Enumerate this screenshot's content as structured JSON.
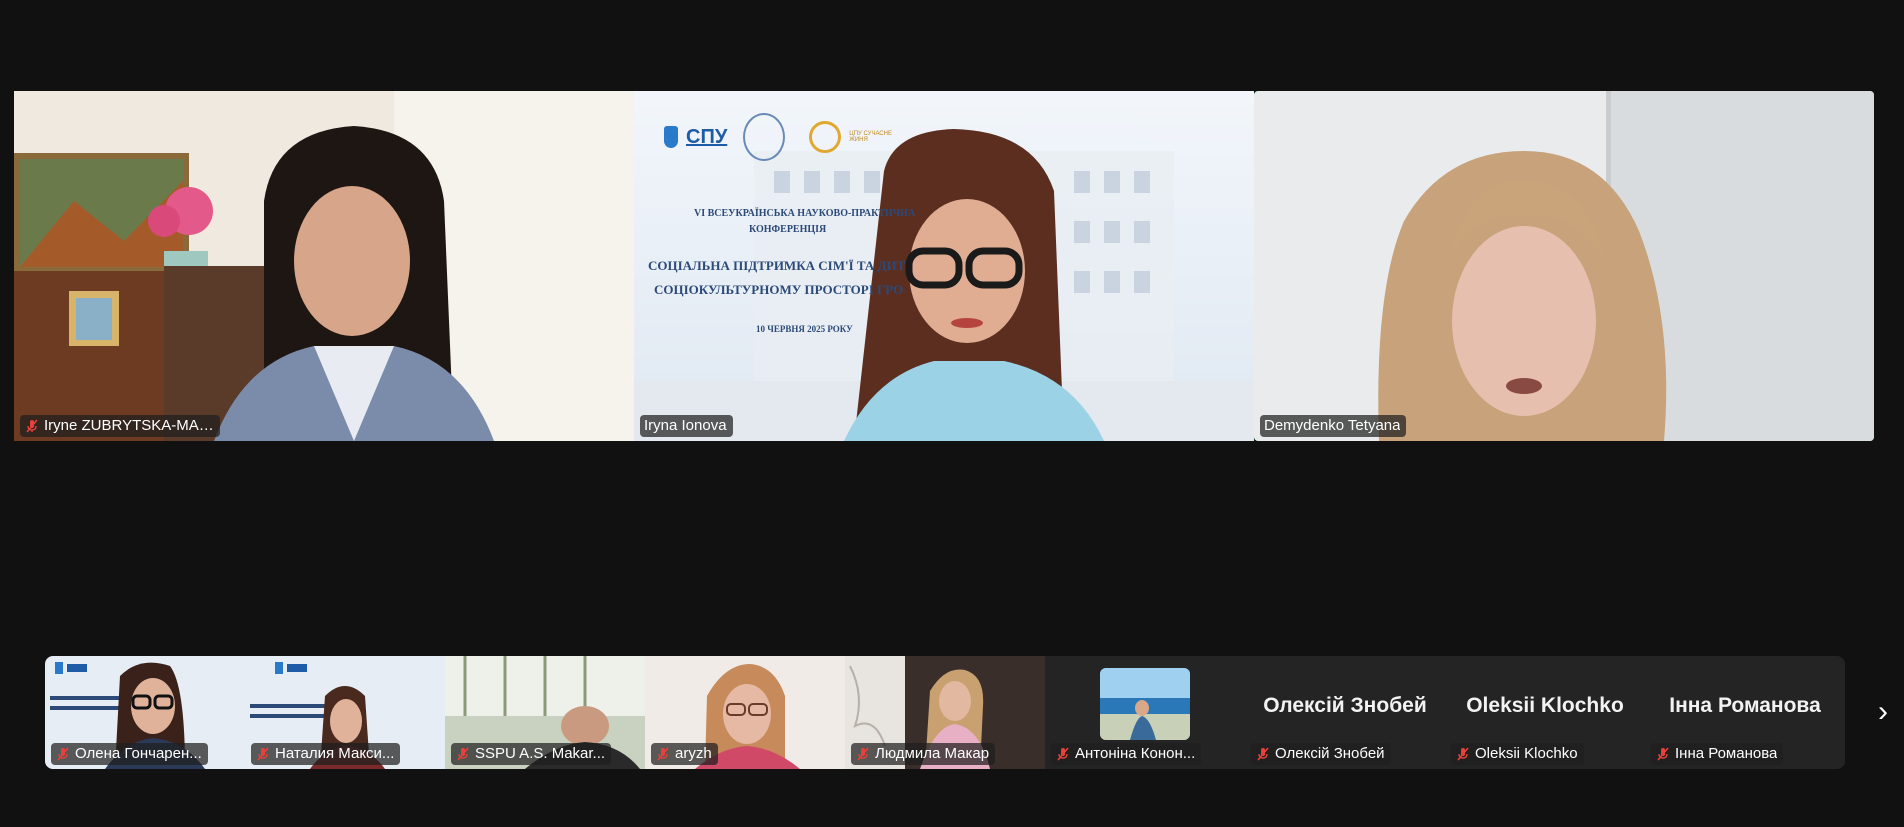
{
  "colors": {
    "background": "#111111",
    "strip_background": "#242424",
    "active_speaker_border": "#23d96b",
    "muted_mic": "#e8403a"
  },
  "main_videos": [
    {
      "name": "Iryne ZUBRYTSKA-MAKOTA",
      "muted": true,
      "active": false
    },
    {
      "name": "Iryna Ionova",
      "muted": false,
      "active": false
    },
    {
      "name": "Demydenko Tetyana",
      "muted": false,
      "active": true
    }
  ],
  "slide": {
    "logo_text": "СПУ",
    "logo_small": "ЦПУ СУЧАСНЕ ЖИНЯ",
    "line1": "VI ВСЕУКРАЇНСЬКА НАУКОВО-ПРАКТИЧНА",
    "line2": "КОНФЕРЕНЦІЯ",
    "title1": "СОЦІАЛЬНА ПІДТРИМКА СІМ'Ї ТА ДИТ",
    "title2": "СОЦІОКУЛЬТУРНОМУ ПРОСТОРІ ГРО",
    "date": "10 ЧЕРВНЯ 2025 РОКУ"
  },
  "thumbnails": [
    {
      "name": "Олена Гончарен...",
      "muted": true,
      "kind": "video-slide"
    },
    {
      "name": "Наталия Макси...",
      "muted": true,
      "kind": "video-slide"
    },
    {
      "name": "SSPU A.S. Makar...",
      "muted": true,
      "kind": "video-room"
    },
    {
      "name": "aryzh",
      "muted": true,
      "kind": "video-person"
    },
    {
      "name": "Людмила Макар",
      "muted": true,
      "kind": "video-person2"
    },
    {
      "name": "Антоніна Конон...",
      "muted": true,
      "kind": "avatar"
    },
    {
      "name": "Олексій Знобей",
      "big": "Олексій Знобей",
      "muted": true,
      "kind": "text"
    },
    {
      "name": "Oleksii Klochko",
      "big": "Oleksii Klochko",
      "muted": true,
      "kind": "text"
    },
    {
      "name": "Інна Романова",
      "big": "Інна Романова",
      "muted": true,
      "kind": "text"
    }
  ],
  "next_page_icon": "chevron-right-icon",
  "next_glyph": "›"
}
